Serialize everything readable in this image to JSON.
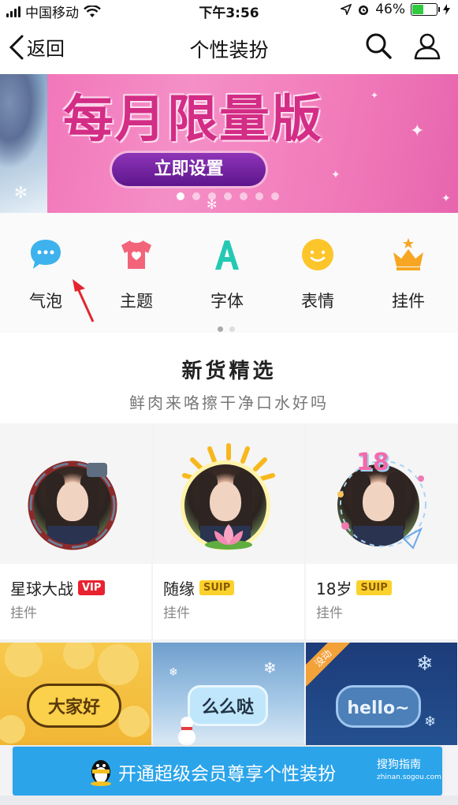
{
  "status_bar": {
    "carrier": "中国移动",
    "time": "下午3:56",
    "battery": "46%",
    "battery_level": 0.46
  },
  "nav": {
    "back_label": "返回",
    "title": "个性装扮"
  },
  "banner": {
    "title": "每月限量版",
    "button": "立即设置",
    "page_count": 7,
    "active_page": 0
  },
  "categories": [
    {
      "label": "气泡",
      "icon": "chat-bubble-icon"
    },
    {
      "label": "主题",
      "icon": "tshirt-icon"
    },
    {
      "label": "字体",
      "icon": "font-a-icon"
    },
    {
      "label": "表情",
      "icon": "smiley-icon"
    },
    {
      "label": "挂件",
      "icon": "crown-icon"
    }
  ],
  "section": {
    "title": "新货精选",
    "subtitle": "鲜肉来咯擦干净口水好吗"
  },
  "products": [
    {
      "name": "星球大战",
      "badge": "VIP",
      "category": "挂件"
    },
    {
      "name": "随缘",
      "badge": "SUIP",
      "category": "挂件"
    },
    {
      "name": "18岁",
      "badge": "SUIP",
      "category": "挂件"
    }
  ],
  "bubbles": [
    {
      "text": "大家好"
    },
    {
      "text": "么么哒"
    },
    {
      "text": "hello~",
      "tag": "没动"
    }
  ],
  "bottom_bar": {
    "text": "开通超级会员尊享个性装扮"
  },
  "watermark": {
    "brand": "搜狗指南",
    "domain": "zhinan.sogou.com"
  },
  "colors": {
    "accent_blue": "#2ba4ea",
    "vip_red": "#e8232f",
    "suip_yellow": "#fbd22d"
  }
}
